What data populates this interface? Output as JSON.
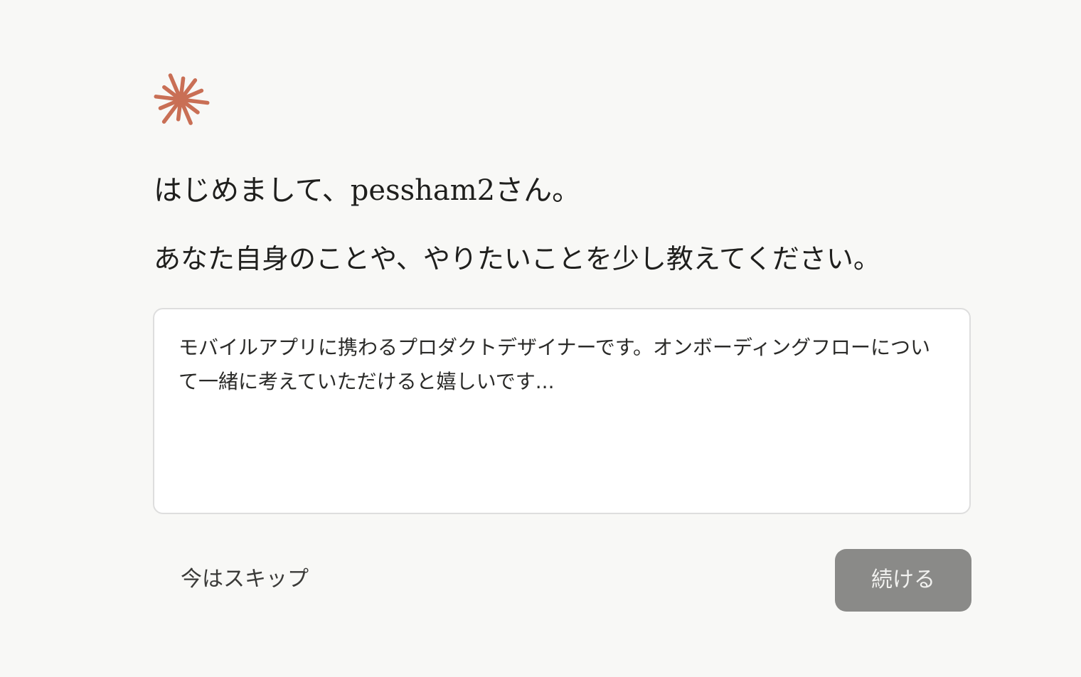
{
  "logo": {
    "icon": "starburst-icon",
    "color": "#c96f55"
  },
  "onboarding": {
    "greeting": "はじめまして、pessham2さん。",
    "prompt": "あなた自身のことや、やりたいことを少し教えてください。",
    "input": {
      "value": "",
      "placeholder": "モバイルアプリに携わるプロダクトデザイナーです。オンボーディングフローについて一緒に考えていただけると嬉しいです..."
    },
    "skip_label": "今はスキップ",
    "continue_label": "続ける"
  },
  "colors": {
    "background": "#f8f8f6",
    "accent": "#c96f55",
    "button_disabled": "#8a8a88"
  }
}
